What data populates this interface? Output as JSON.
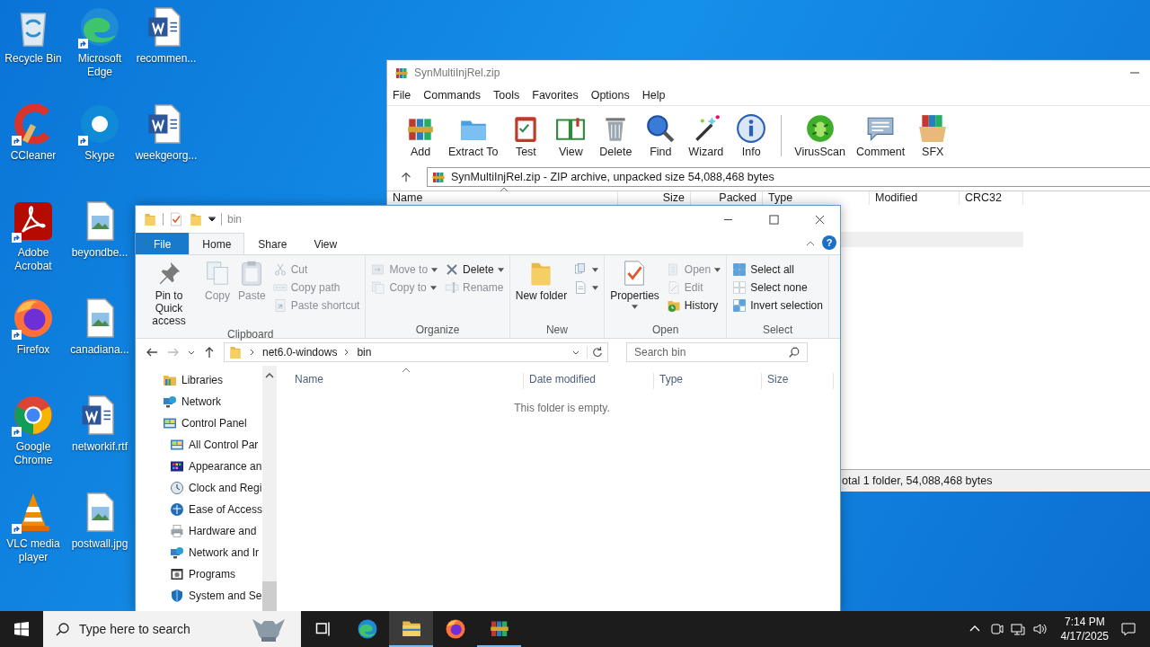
{
  "desktop_icons": [
    {
      "label": "Recycle Bin",
      "kind": "recycle",
      "shortcut": false
    },
    {
      "label": "CCleaner",
      "kind": "ccleaner",
      "shortcut": true
    },
    {
      "label": "Adobe Acrobat",
      "kind": "acrobat",
      "shortcut": true
    },
    {
      "label": "Firefox",
      "kind": "firefox",
      "shortcut": true
    },
    {
      "label": "Google Chrome",
      "kind": "chrome",
      "shortcut": true
    },
    {
      "label": "VLC media player",
      "kind": "vlc",
      "shortcut": true
    },
    {
      "label": "Microsoft Edge",
      "kind": "edge",
      "shortcut": true
    },
    {
      "label": "Skype",
      "kind": "skype",
      "shortcut": true
    },
    {
      "label": "beyondbe...",
      "kind": "image",
      "shortcut": false
    },
    {
      "label": "canadiana...",
      "kind": "image",
      "shortcut": false
    },
    {
      "label": "networkif.rtf",
      "kind": "word",
      "shortcut": false
    },
    {
      "label": "postwall.jpg",
      "kind": "image",
      "shortcut": false
    },
    {
      "label": "recommen...",
      "kind": "word",
      "shortcut": false
    },
    {
      "label": "weekgeorg...",
      "kind": "word",
      "shortcut": false
    }
  ],
  "winrar": {
    "title": "SynMultiInjRel.zip",
    "menu": [
      "File",
      "Commands",
      "Tools",
      "Favorites",
      "Options",
      "Help"
    ],
    "toolbar": [
      [
        {
          "label": "Add",
          "kind": "add"
        },
        {
          "label": "Extract To",
          "kind": "extract"
        },
        {
          "label": "Test",
          "kind": "test"
        },
        {
          "label": "View",
          "kind": "view"
        },
        {
          "label": "Delete",
          "kind": "trash"
        },
        {
          "label": "Find",
          "kind": "find"
        },
        {
          "label": "Wizard",
          "kind": "wizard"
        },
        {
          "label": "Info",
          "kind": "info"
        }
      ],
      [
        {
          "label": "VirusScan",
          "kind": "virusscan"
        },
        {
          "label": "Comment",
          "kind": "comment"
        },
        {
          "label": "SFX",
          "kind": "sfx"
        }
      ]
    ],
    "address": "SynMultiInjRel.zip - ZIP archive, unpacked size 54,088,468 bytes",
    "columns": [
      "Name",
      "Size",
      "Packed",
      "Type",
      "Modified",
      "CRC32"
    ],
    "status": "otal 1 folder, 54,088,468 bytes"
  },
  "explorer": {
    "title": "bin",
    "tabs": [
      {
        "label": "File",
        "kind": "file",
        "selected": false
      },
      {
        "label": "Home",
        "kind": "tab",
        "selected": true
      },
      {
        "label": "Share",
        "kind": "tab",
        "selected": false
      },
      {
        "label": "View",
        "kind": "tab",
        "selected": false
      }
    ],
    "help": "?",
    "ribbon": [
      {
        "label": "Clipboard",
        "columns": [
          {
            "kind": "large",
            "items": [
              {
                "label": "Pin to Quick access",
                "kind": "pin",
                "disabled": false,
                "dropdown": false
              }
            ]
          },
          {
            "kind": "large",
            "items": [
              {
                "label": "Copy",
                "kind": "copy",
                "disabled": true,
                "dropdown": false
              }
            ]
          },
          {
            "kind": "large",
            "items": [
              {
                "label": "Paste",
                "kind": "paste",
                "disabled": true,
                "dropdown": false
              }
            ]
          },
          {
            "kind": "small",
            "items": [
              {
                "label": "Cut",
                "kind": "cut",
                "disabled": true,
                "dropdown": false
              },
              {
                "label": "Copy path",
                "kind": "copypath",
                "disabled": true,
                "dropdown": false
              },
              {
                "label": "Paste shortcut",
                "kind": "pasteshortcut",
                "disabled": true,
                "dropdown": false
              }
            ]
          }
        ]
      },
      {
        "label": "Organize",
        "columns": [
          {
            "kind": "small",
            "items": [
              {
                "label": "Move to",
                "kind": "moveto",
                "disabled": true,
                "dropdown": true
              },
              {
                "label": "Copy to",
                "kind": "copyto",
                "disabled": true,
                "dropdown": true
              }
            ]
          },
          {
            "kind": "small",
            "items": [
              {
                "label": "Delete",
                "kind": "xmark",
                "disabled": false,
                "dropdown": true
              },
              {
                "label": "Rename",
                "kind": "rename",
                "disabled": true,
                "dropdown": false
              }
            ]
          }
        ]
      },
      {
        "label": "New",
        "columns": [
          {
            "kind": "large",
            "items": [
              {
                "label": "New folder",
                "kind": "newfolder",
                "disabled": false,
                "dropdown": false
              }
            ]
          },
          {
            "kind": "small",
            "items": [
              {
                "kind": "newitem",
                "disabled": false,
                "dropdown": true
              },
              {
                "kind": "easyaccess",
                "disabled": false,
                "dropdown": true
              }
            ]
          }
        ]
      },
      {
        "label": "Open",
        "columns": [
          {
            "kind": "large",
            "items": [
              {
                "label": "Properties",
                "kind": "properties",
                "disabled": false,
                "dropdown": true
              }
            ]
          },
          {
            "kind": "small",
            "items": [
              {
                "label": "Open",
                "kind": "open",
                "disabled": true,
                "dropdown": true
              },
              {
                "label": "Edit",
                "kind": "edit",
                "disabled": true,
                "dropdown": false
              },
              {
                "label": "History",
                "kind": "history",
                "disabled": false,
                "dropdown": false
              }
            ]
          }
        ]
      },
      {
        "label": "Select",
        "columns": [
          {
            "kind": "small",
            "items": [
              {
                "label": "Select all",
                "kind": "selectall",
                "disabled": false,
                "dropdown": false
              },
              {
                "label": "Select none",
                "kind": "selectnone",
                "disabled": false,
                "dropdown": false
              },
              {
                "label": "Invert selection",
                "kind": "invert",
                "disabled": false,
                "dropdown": false
              }
            ]
          }
        ]
      }
    ],
    "path": [
      "net6.0-windows",
      "bin"
    ],
    "search_placeholder": "Search bin",
    "tree": [
      {
        "label": "Libraries",
        "kind": "libraries"
      },
      {
        "label": "Network",
        "kind": "network"
      },
      {
        "label": "Control Panel",
        "kind": "control",
        "children": [
          {
            "label": "All Control Par",
            "kind": "control"
          },
          {
            "label": "Appearance an",
            "kind": "appearance"
          },
          {
            "label": "Clock and Regi",
            "kind": "clock"
          },
          {
            "label": "Ease of Access",
            "kind": "ease"
          },
          {
            "label": "Hardware and",
            "kind": "hardware"
          },
          {
            "label": "Network and Ir",
            "kind": "network"
          },
          {
            "label": "Programs",
            "kind": "programs"
          },
          {
            "label": "System and Se",
            "kind": "system"
          }
        ]
      }
    ],
    "columns": [
      "Name",
      "Date modified",
      "Type",
      "Size"
    ],
    "empty_message": "This folder is empty."
  },
  "taskbar": {
    "search_placeholder": "Type here to search",
    "apps": [
      {
        "kind": "taskview",
        "selected": false,
        "running": false
      },
      {
        "kind": "edge",
        "selected": false,
        "running": false
      },
      {
        "kind": "explorer",
        "selected": true,
        "running": true
      },
      {
        "kind": "firefox",
        "selected": false,
        "running": false
      },
      {
        "kind": "add",
        "selected": false,
        "running": true
      }
    ],
    "time": "7:14 PM",
    "date": "4/17/2025"
  }
}
